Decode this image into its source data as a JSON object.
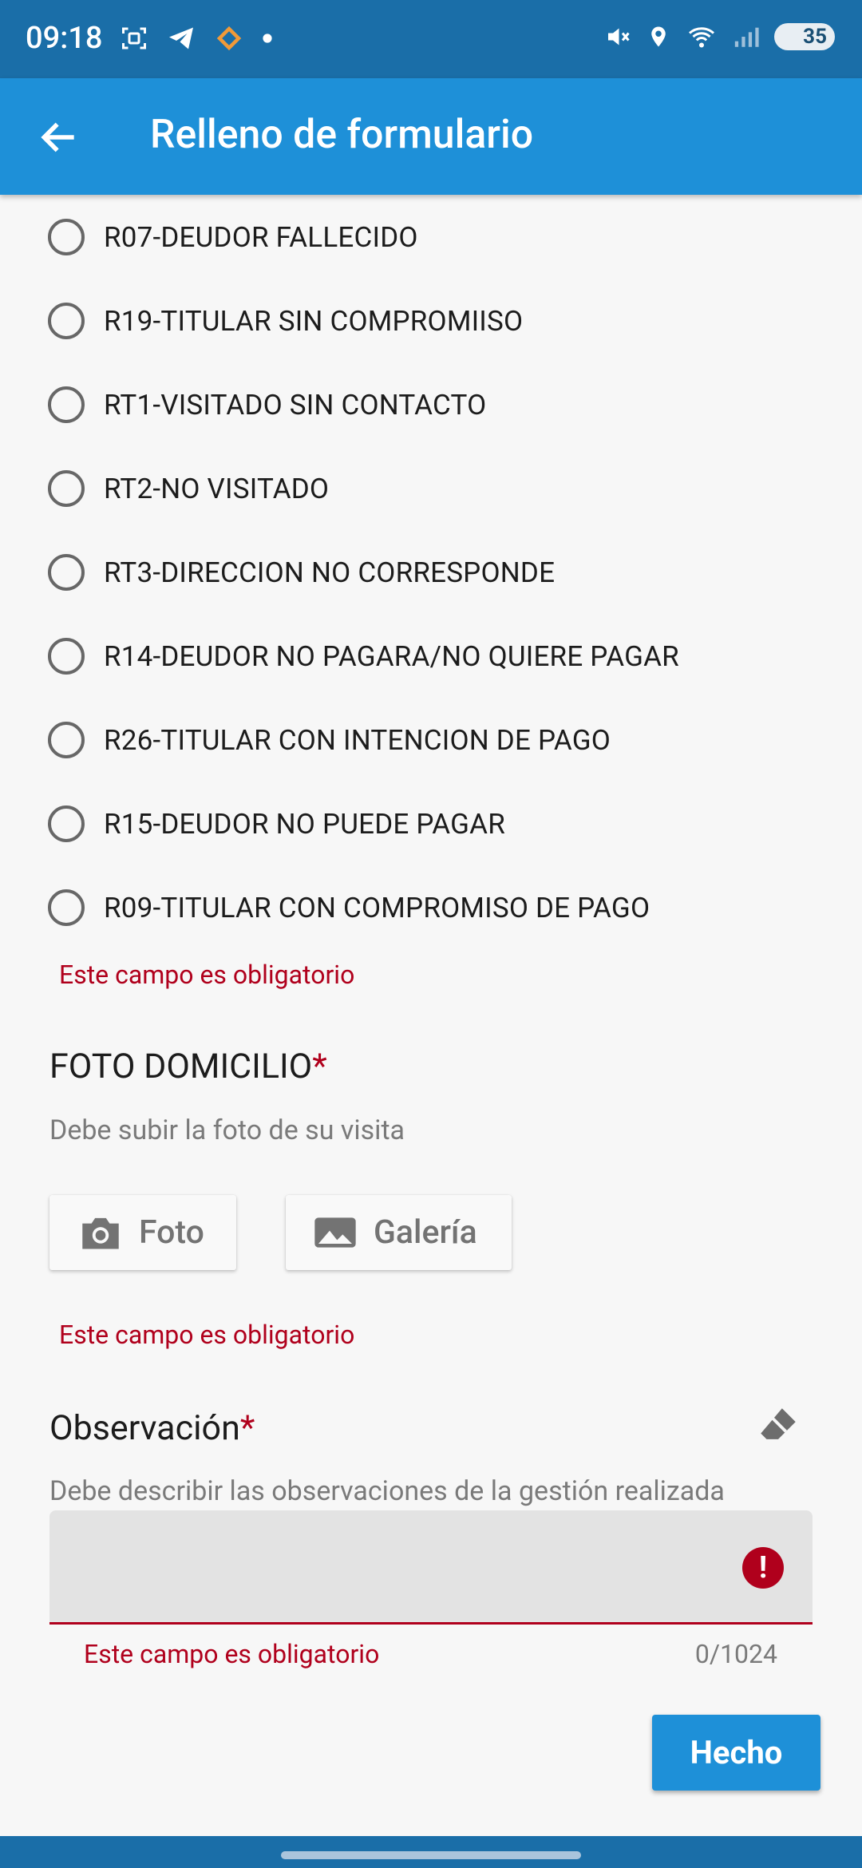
{
  "status_bar": {
    "time": "09:18",
    "battery": "35",
    "icons": [
      "screenshot-icon",
      "telegram-icon",
      "app-heart-icon",
      "dot-icon",
      "mute-icon",
      "location-icon",
      "wifi-icon",
      "signal-icon",
      "battery-icon"
    ]
  },
  "app_bar": {
    "title": "Relleno de formulario",
    "back_icon": "arrow-left-icon"
  },
  "radio_options": [
    "R07-DEUDOR FALLECIDO",
    "R19-TITULAR SIN COMPROMIISO",
    "RT1-VISITADO SIN CONTACTO",
    "RT2-NO VISITADO",
    "RT3-DIRECCION NO CORRESPONDE",
    "R14-DEUDOR NO PAGARA/NO QUIERE PAGAR",
    "R26-TITULAR CON INTENCION DE PAGO",
    "R15-DEUDOR NO PUEDE PAGAR",
    "R09-TITULAR CON COMPROMISO DE PAGO"
  ],
  "radio_error": "Este campo es obligatorio",
  "photo_section": {
    "title": "FOTO DOMICILIO",
    "required_mark": "*",
    "hint": "Debe subir la foto de su visita",
    "photo_button": "Foto",
    "gallery_button": "Galería",
    "error": "Este campo es obligatorio"
  },
  "observation_section": {
    "title": "Observación",
    "required_mark": "*",
    "hint": "Debe describir las observaciones de la gestión realizada",
    "value": "",
    "error": "Este campo es obligatorio",
    "counter": "0/1024"
  },
  "done_button": "Hecho",
  "colors": {
    "primary": "#1e90d8",
    "status_bar": "#1a6ea8",
    "error": "#b0001c"
  }
}
